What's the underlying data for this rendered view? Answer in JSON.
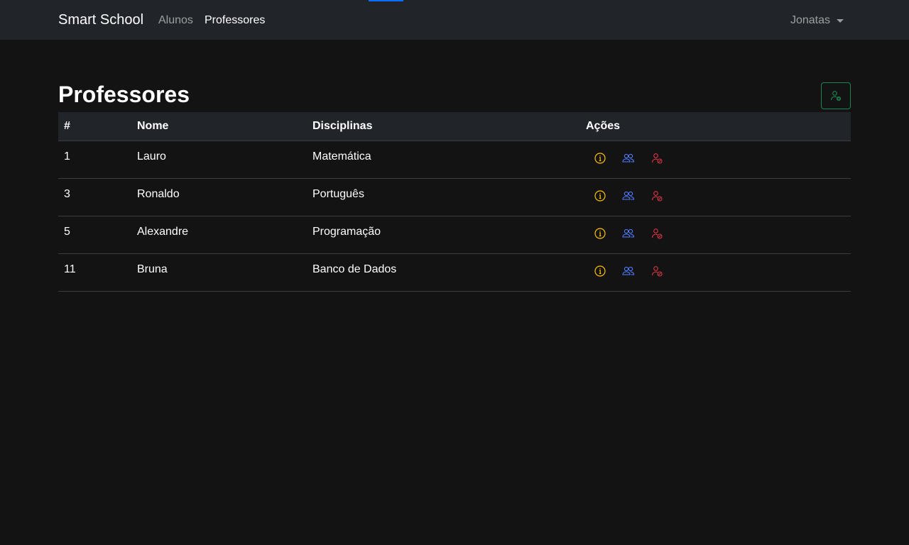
{
  "navbar": {
    "brand": "Smart School",
    "links": [
      {
        "label": "Alunos",
        "active": false
      },
      {
        "label": "Professores",
        "active": true
      }
    ],
    "user": "Jonatas"
  },
  "page": {
    "title": "Professores",
    "add_icon": "person-add-icon"
  },
  "table": {
    "headers": [
      "#",
      "Nome",
      "Disciplinas",
      "Ações"
    ],
    "rows": [
      {
        "id": "1",
        "nome": "Lauro",
        "disciplinas": "Matemática"
      },
      {
        "id": "3",
        "nome": "Ronaldo",
        "disciplinas": "Português"
      },
      {
        "id": "5",
        "nome": "Alexandre",
        "disciplinas": "Programação"
      },
      {
        "id": "11",
        "nome": "Bruna",
        "disciplinas": "Banco de Dados"
      }
    ],
    "actions": [
      {
        "icon": "info-icon",
        "color": "#ffc107"
      },
      {
        "icon": "people-icon",
        "color": "#4f7cff"
      },
      {
        "icon": "person-remove-icon",
        "color": "#dc3545"
      }
    ]
  },
  "colors": {
    "background": "#131313",
    "navbar": "#212529",
    "success": "#198754",
    "warning": "#ffc107",
    "primary": "#4f7cff",
    "danger": "#dc3545"
  }
}
